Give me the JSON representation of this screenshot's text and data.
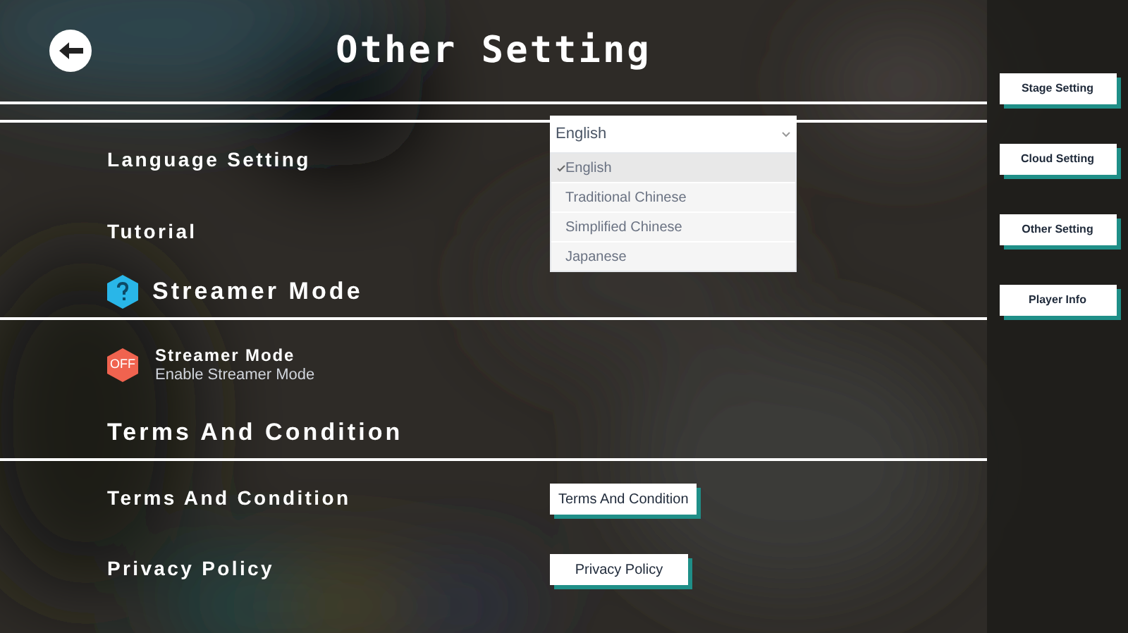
{
  "header": {
    "title": "Other Setting"
  },
  "sections": [
    {
      "rows": [
        {
          "kind": "dropdown",
          "label": "Language Setting",
          "value": "English",
          "options": [
            {
              "label": "English",
              "selected": true
            },
            {
              "label": "Traditional Chinese",
              "selected": false
            },
            {
              "label": "Simplified Chinese",
              "selected": false
            },
            {
              "label": "Japanese",
              "selected": false
            }
          ],
          "expanded": true
        },
        {
          "kind": "plain",
          "label": "Tutorial"
        }
      ]
    },
    {
      "heading": "Streamer Mode",
      "rows": [
        {
          "kind": "toggle",
          "label": "Streamer Mode",
          "description": "Enable Streamer Mode",
          "on": false,
          "state_label": "OFF"
        }
      ]
    },
    {
      "heading": "Terms And Condition",
      "rows": [
        {
          "kind": "button",
          "label": "Terms And Condition",
          "button": "Terms And Condition"
        },
        {
          "kind": "button",
          "label": "Privacy Policy",
          "button": "Privacy Policy"
        }
      ]
    }
  ],
  "sidebar": {
    "items": [
      "Stage Setting",
      "Cloud Setting",
      "Other Setting",
      "Player Info"
    ]
  }
}
